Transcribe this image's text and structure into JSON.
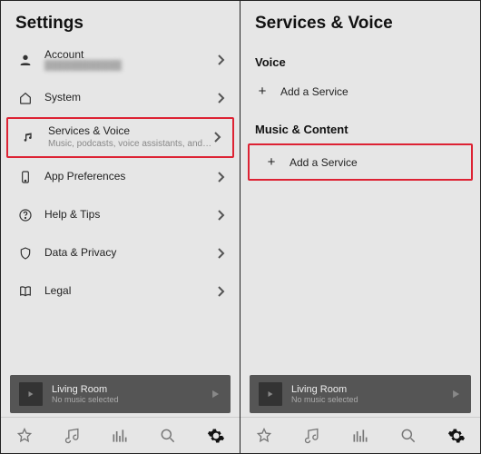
{
  "left": {
    "title": "Settings",
    "items": [
      {
        "label": "Account",
        "sub_blurred": "████████████"
      },
      {
        "label": "System"
      },
      {
        "label": "Services & Voice",
        "sub": "Music, podcasts, voice assistants, and more",
        "highlight": true
      },
      {
        "label": "App Preferences"
      },
      {
        "label": "Help & Tips"
      },
      {
        "label": "Data & Privacy"
      },
      {
        "label": "Legal"
      }
    ]
  },
  "right": {
    "title": "Services & Voice",
    "sections": [
      {
        "heading": "Voice",
        "action": "Add a Service",
        "highlight": false
      },
      {
        "heading": "Music & Content",
        "action": "Add a Service",
        "highlight": true
      }
    ]
  },
  "now_playing": {
    "room": "Living Room",
    "status": "No music selected"
  }
}
